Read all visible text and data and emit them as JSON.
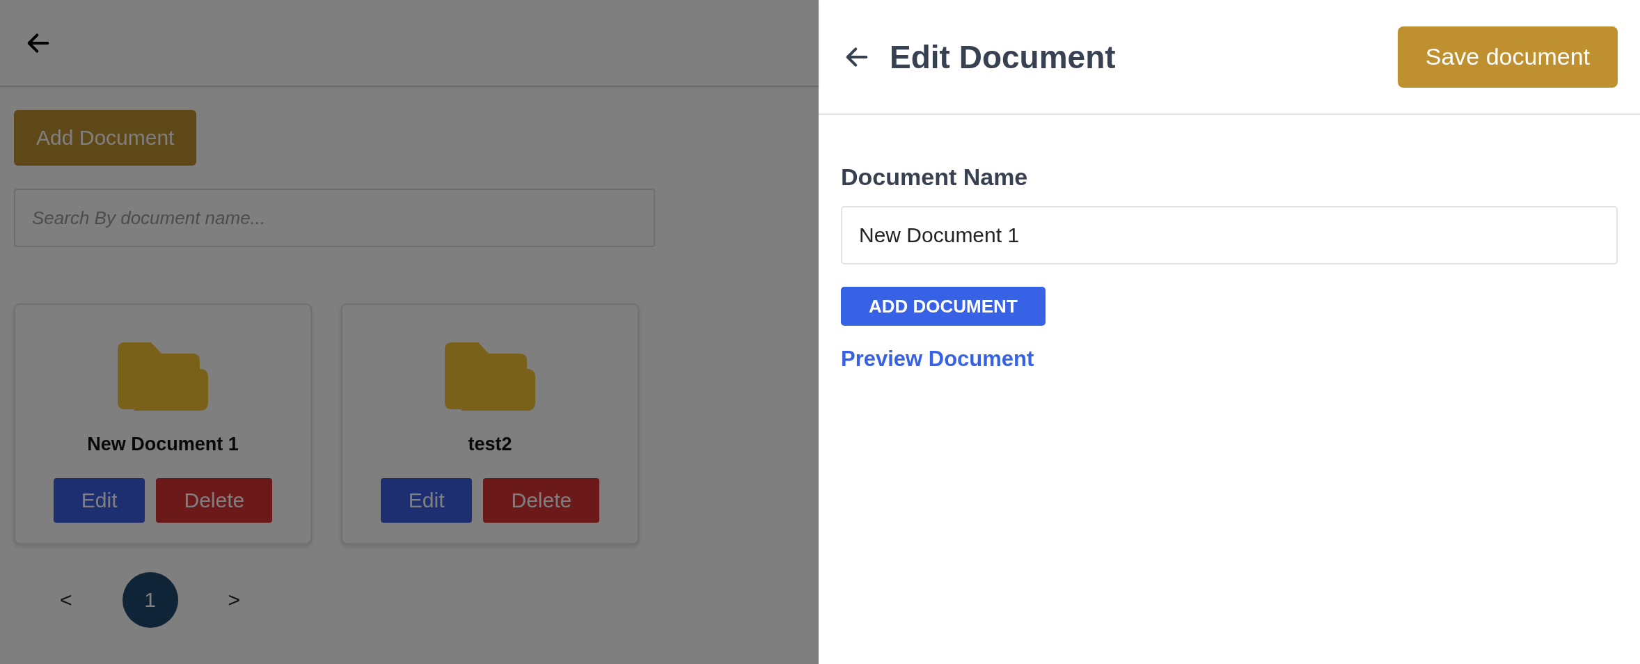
{
  "page": {
    "add_button": "Add Document",
    "search": {
      "placeholder": "Search By document name..."
    },
    "documents": [
      {
        "name": "New Document 1",
        "edit": "Edit",
        "delete": "Delete"
      },
      {
        "name": "test2",
        "edit": "Edit",
        "delete": "Delete"
      }
    ],
    "pagination": {
      "prev": "<",
      "next": ">",
      "pages": [
        {
          "label": "1",
          "selected": true
        }
      ]
    }
  },
  "drawer": {
    "title": "Edit Document",
    "save_button": "Save document",
    "field_label": "Document Name",
    "field_value": "New Document 1",
    "add_button": "ADD DOCUMENT",
    "preview_link": "Preview Document"
  }
}
